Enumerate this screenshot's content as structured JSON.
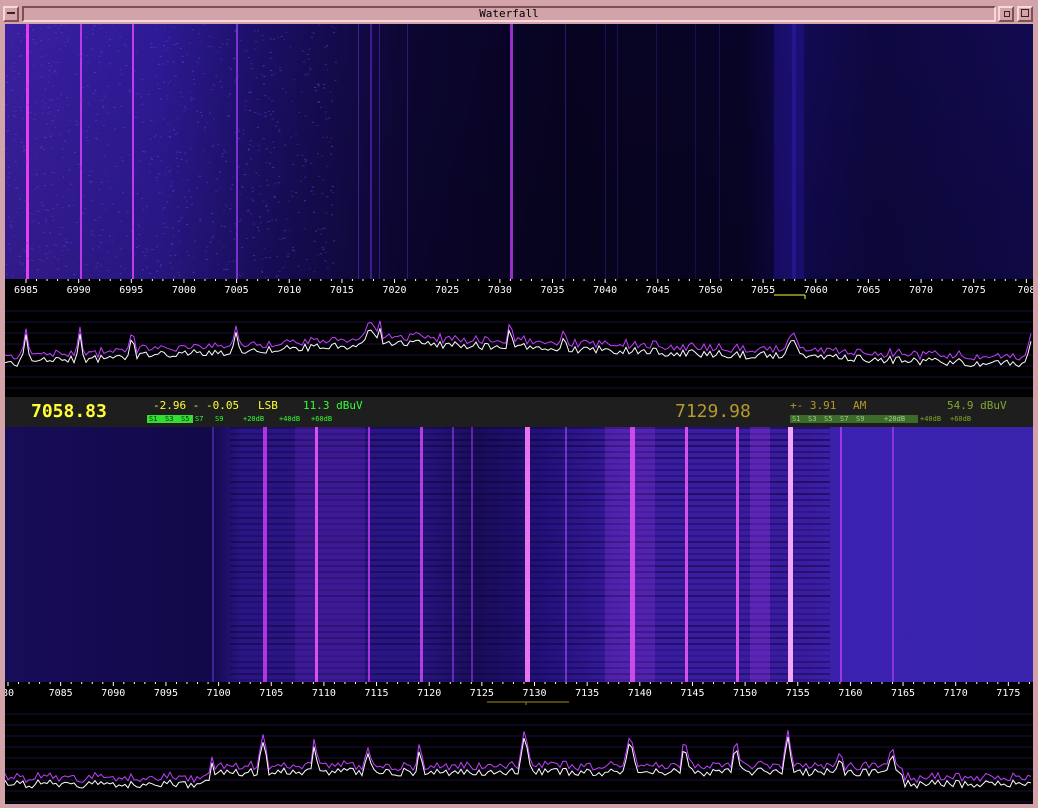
{
  "window": {
    "title": "Waterfall"
  },
  "top": {
    "ticks": [
      "6985",
      "6990",
      "6995",
      "7000",
      "7005",
      "7010",
      "7015",
      "7020",
      "7025",
      "7030",
      "7035",
      "7040",
      "7045",
      "7050",
      "7055",
      "7060",
      "7065",
      "7070",
      "7075",
      "708"
    ]
  },
  "bottom": {
    "ticks": [
      "80",
      "7085",
      "7090",
      "7095",
      "7100",
      "7105",
      "7110",
      "7115",
      "7120",
      "7125",
      "7130",
      "7135",
      "7140",
      "7145",
      "7150",
      "7155",
      "7160",
      "7165",
      "7170",
      "7175"
    ]
  },
  "status": {
    "rx1": {
      "freq": "7058.83",
      "offset": "-2.96 - -0.05",
      "mode": "LSB",
      "level": "11.3 dBuV",
      "smeter": [
        "S1",
        "S3",
        "S5",
        "S7",
        "S9",
        "+20dB",
        "+40dB",
        "+60dB"
      ]
    },
    "rx2": {
      "freq": "7129.98",
      "offset": "+- 3.91",
      "mode": "AM",
      "level": "54.9 dBuV",
      "smeter": [
        "S1",
        "S3",
        "S5",
        "S7",
        "S9",
        "+20dB",
        "+40dB",
        "+60dB"
      ]
    }
  },
  "colors": {
    "freq_rx1": "#ffff33",
    "freq_rx2": "#b39a2a",
    "info_rx1": "#ffff33",
    "info_rx2": "#b39a2a",
    "level_green": "#33ff33",
    "level_dim": "#7fa82f",
    "marker_rx1": "#ffff33",
    "marker_rx2": "#a08a22"
  }
}
